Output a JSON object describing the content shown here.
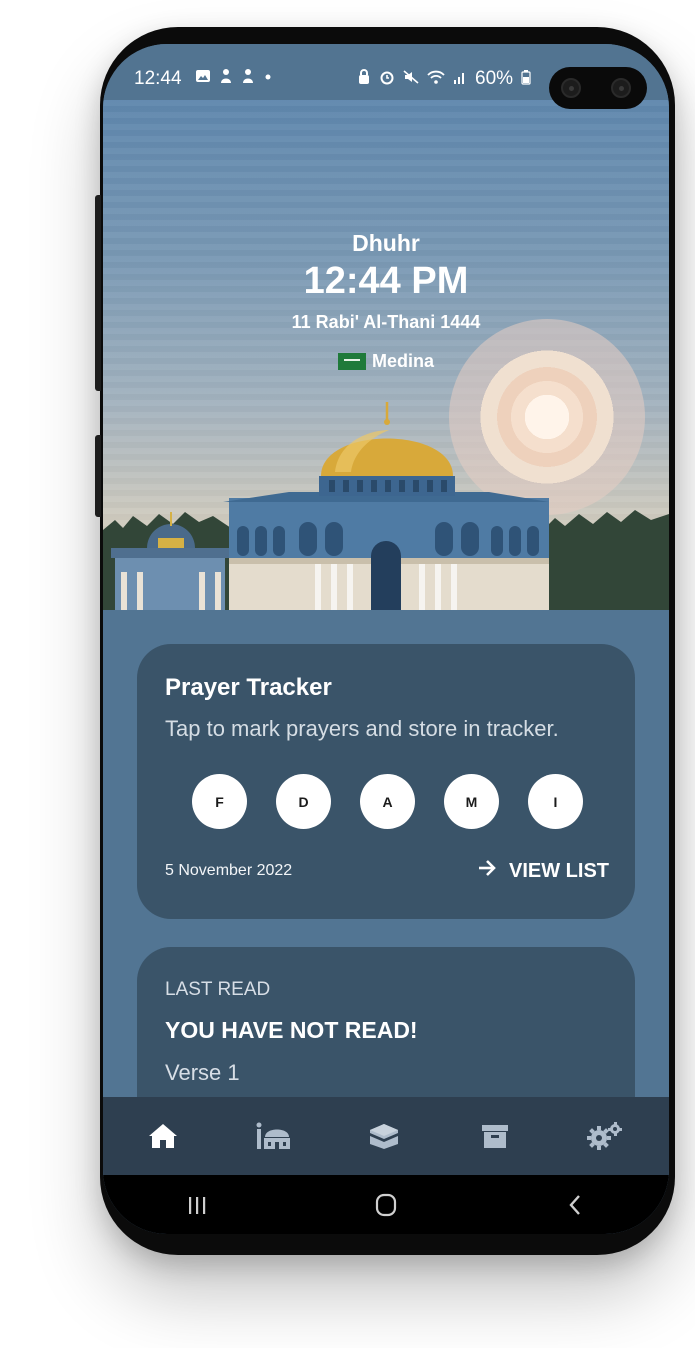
{
  "status_bar": {
    "time": "12:44",
    "battery": "60%",
    "left_icons": [
      "gallery-icon",
      "person-icon",
      "person-icon",
      "dot-icon"
    ],
    "right_icons": [
      "lock-icon",
      "alarm-icon",
      "mute-icon",
      "wifi-icon",
      "signal-icon",
      "battery-icon"
    ]
  },
  "hero": {
    "prayer_name": "Dhuhr",
    "prayer_time": "12:44 PM",
    "hijri_date": "11 Rabi' Al-Thani 1444",
    "location": "Medina"
  },
  "prayer_tracker": {
    "title": "Prayer Tracker",
    "subtitle": "Tap to mark prayers and store in tracker.",
    "prayers": [
      "F",
      "D",
      "A",
      "M",
      "I"
    ],
    "date": "5 November 2022",
    "view_list_label": "VIEW LIST"
  },
  "last_read": {
    "label": "LAST READ",
    "title": "YOU HAVE NOT READ!",
    "verse": "Verse 1"
  },
  "bottom_nav": {
    "items": [
      "home-icon",
      "mosque-icon",
      "kaaba-icon",
      "archive-icon",
      "settings-icon"
    ],
    "active": "home-icon"
  },
  "colors": {
    "background": "#527593",
    "card": "#3a5469",
    "nav": "#2e3f50",
    "dome": "#d8a93a"
  }
}
